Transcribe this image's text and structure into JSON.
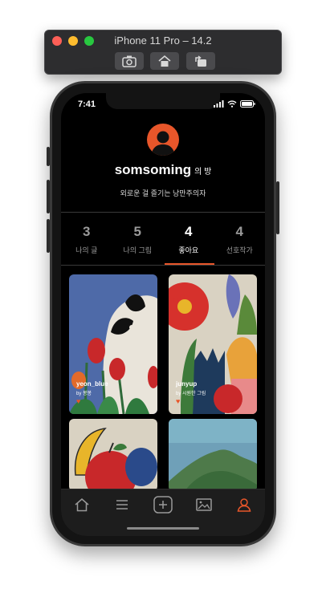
{
  "simulator": {
    "title": "iPhone 11 Pro – 14.2",
    "buttons": [
      "screenshot-icon",
      "home-icon",
      "rotate-icon"
    ]
  },
  "status_bar": {
    "time": "7:41",
    "icons": [
      "signal-icon",
      "wifi-icon",
      "battery-icon"
    ]
  },
  "profile": {
    "name": "somsoming",
    "suffix": "의 방",
    "bio": "외로운 걸 즐기는 낭만주의자",
    "avatar_color": "#e8562a"
  },
  "stats": [
    {
      "count": "3",
      "label": "나의 글"
    },
    {
      "count": "5",
      "label": "나의 그림"
    },
    {
      "count": "4",
      "label": "좋아요"
    },
    {
      "count": "4",
      "label": "선호작가"
    }
  ],
  "active_stat": 2,
  "cards": [
    {
      "title": "yeon_blue",
      "by": "by 봉봉"
    },
    {
      "title": "junyup",
      "by": "by 시원한 그림"
    },
    {
      "title": "",
      "by": ""
    },
    {
      "title": "",
      "by": ""
    }
  ],
  "tabbar": {
    "items": [
      "home-icon",
      "list-icon",
      "add-icon",
      "gallery-icon",
      "profile-icon"
    ],
    "active_index": 4
  },
  "colors": {
    "accent": "#e8562a",
    "background": "#000000",
    "tabbar": "#1d1d1d"
  }
}
